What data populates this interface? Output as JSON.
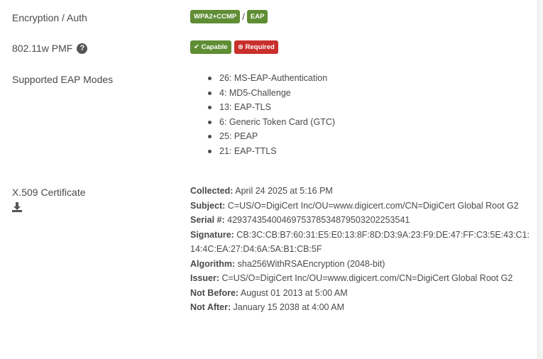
{
  "encryption": {
    "label": "Encryption / Auth",
    "badges": [
      "WPA2+CCMP",
      "EAP"
    ],
    "separator": "/"
  },
  "pmf": {
    "label": "802.11w PMF",
    "help_icon": "question-circle-icon",
    "capable": "Capable",
    "required": "Required"
  },
  "eap_modes": {
    "label": "Supported EAP Modes",
    "items": [
      "26: MS-EAP-Authentication",
      "4: MD5-Challenge",
      "13: EAP-TLS",
      "6: Generic Token Card (GTC)",
      "25: PEAP",
      "21: EAP-TTLS"
    ]
  },
  "certificate": {
    "label": "X.509 Certificate",
    "download_icon": "download-icon",
    "fields": [
      {
        "key": "Collected:",
        "value": "April 24 2025 at 5:16 PM"
      },
      {
        "key": "Subject:",
        "value": "C=US/O=DigiCert Inc/OU=www.digicert.com/CN=DigiCert Global Root G2"
      },
      {
        "key": "Serial #:",
        "value": "4293743540046975378534879503202253541"
      },
      {
        "key": "Signature:",
        "value": "CB:3C:CB:B7:60:31:E5:E0:13:8F:8D:D3:9A:23:F9:DE:47:FF:C3:5E:43:C1:14:4C:EA:27:D4:6A:5A:B1:CB:5F"
      },
      {
        "key": "Algorithm:",
        "value": "sha256WithRSAEncryption (2048-bit)"
      },
      {
        "key": "Issuer:",
        "value": "C=US/O=DigiCert Inc/OU=www.digicert.com/CN=DigiCert Global Root G2"
      },
      {
        "key": "Not Before:",
        "value": "August 01 2013 at 5:00 AM"
      },
      {
        "key": "Not After:",
        "value": "January 15 2038 at 4:00 AM"
      }
    ]
  },
  "colors": {
    "badge_green": "#5f8d34",
    "badge_red": "#c9302c",
    "text": "#4a4a4a"
  }
}
